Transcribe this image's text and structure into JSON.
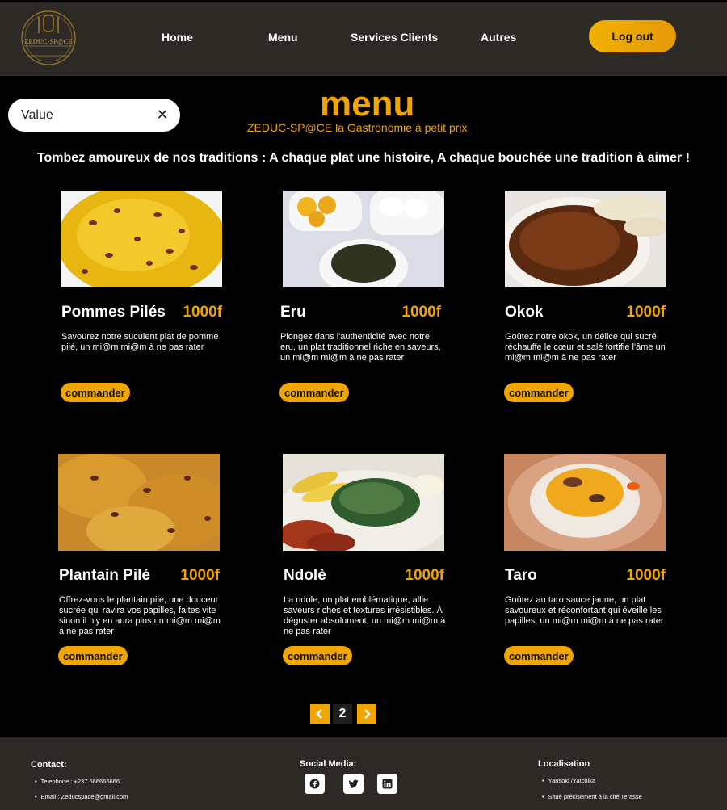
{
  "header": {
    "logo_text": "ZEDUC-SP@CE",
    "nav": [
      "Home",
      "Menu",
      "Services Clients",
      "Autres"
    ],
    "logout_label": "Log out"
  },
  "search": {
    "value": "Value",
    "clear_icon": "close-icon"
  },
  "page_title": "menu",
  "subtitle": "ZEDUC-SP@CE la Gastronomie à petit prix",
  "tagline": "Tombez amoureux de nos traditions : A chaque plat une histoire, A chaque bouchée une tradition à aimer !",
  "dishes": [
    {
      "name": "Pommes Pilés",
      "price": "1000f",
      "description": "Savourez notre suculent plat de pomme pilé,  un mi@m mi@m à ne pas rater",
      "button": "commander"
    },
    {
      "name": "Eru",
      "price": "1000f",
      "description": "Plongez dans l'authenticité avec notre eru, un plat traditionnel riche en saveurs, un mi@m mi@m à ne pas rater",
      "button": "commander"
    },
    {
      "name": "Okok",
      "price": "1000f",
      "description": "Goûtez notre okok, un délice qui sucré réchauffe le cœur et salé fortifie l'âme un mi@m mi@m à ne pas rater",
      "button": "commander"
    },
    {
      "name": "Plantain Pilé",
      "price": "1000f",
      "description": " Offrez-vous le plantain pilé, une douceur sucrée qui ravira vos papilles, faites vite sinon il n'y en aura plus,un mi@m mi@m à ne pas rater",
      "button": "commander"
    },
    {
      "name": "Ndolè",
      "price": "1000f",
      "description": "La ndole, un plat emblématique, allie saveurs riches et textures irrésistibles. À déguster absolument, un mi@m mi@m à ne pas rater",
      "button": "commander"
    },
    {
      "name": "Taro",
      "price": "1000f",
      "description": "Goûtez au taro sauce jaune, un plat savoureux et réconfortant qui éveille les papilles, un mi@m mi@m à ne pas rater",
      "button": "commander"
    }
  ],
  "pagination": {
    "current": "2",
    "prev_icon": "chevron-left-icon",
    "next_icon": "chevron-right-icon"
  },
  "footer": {
    "contact": {
      "title": "Contact:",
      "items": [
        "Telephone : +237 666666666",
        "Email : Zeducspace@gmail.com"
      ]
    },
    "social": {
      "title": "Social Media:",
      "icons": [
        "facebook-icon",
        "twitter-icon",
        "linkedin-icon"
      ]
    },
    "location": {
      "title": "Localisation",
      "items": [
        "Yansoki /Yatchika",
        "Situé précisément à la cité Terasse"
      ]
    }
  },
  "colors": {
    "accent": "#f0a500",
    "header_bg": "#2d2a26",
    "page_bg": "#000000"
  }
}
